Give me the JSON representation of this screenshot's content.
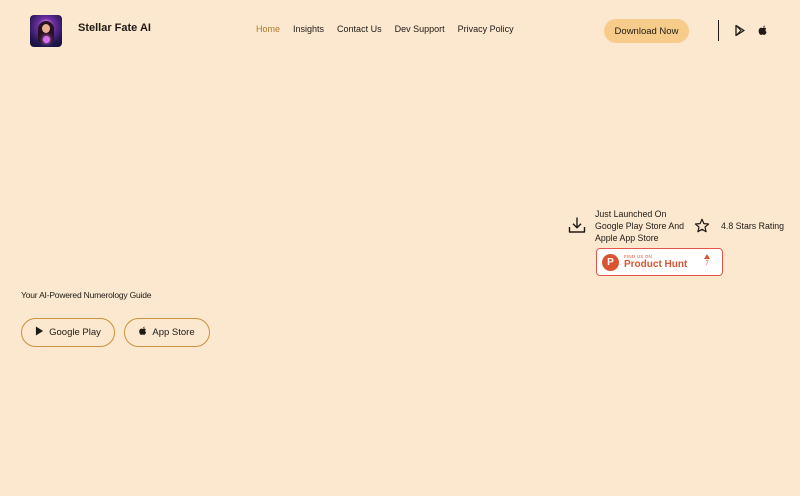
{
  "brand": {
    "name": "Stellar Fate AI",
    "logo_icon": "fortune-teller-logo"
  },
  "nav": {
    "items": [
      {
        "label": "Home",
        "active": true
      },
      {
        "label": "Insights",
        "active": false
      },
      {
        "label": "Contact Us",
        "active": false
      },
      {
        "label": "Dev Support",
        "active": false
      },
      {
        "label": "Privacy Policy",
        "active": false
      }
    ]
  },
  "header": {
    "download_label": "Download Now",
    "icons": [
      "google-play-icon",
      "apple-icon"
    ]
  },
  "hero": {
    "tagline": "Your AI-Powered Numerology Guide",
    "google_play_label": "Google Play",
    "app_store_label": "App Store",
    "launch_text": "Just Launched On Google Play Store And Apple App Store",
    "rating_text": "4.8 Stars Rating"
  },
  "product_hunt": {
    "find_us": "FIND US ON",
    "name": "Product Hunt",
    "logo_letter": "P",
    "votes": "7"
  },
  "colors": {
    "background": "#fbe8cf",
    "accent": "#f7cc8b",
    "active_nav": "#b07a2a",
    "button_border": "#c9933f",
    "product_hunt": "#da552f"
  }
}
